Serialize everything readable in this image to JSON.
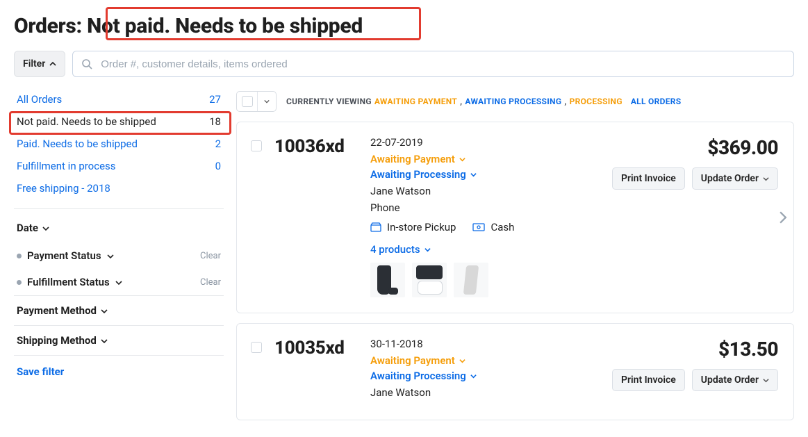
{
  "header": {
    "title_prefix": "Orders:",
    "title_filter": "Not paid. Needs to be shipped"
  },
  "filterBar": {
    "filter_label": "Filter",
    "search_placeholder": "Order #, customer details, items ordered"
  },
  "sidebar": {
    "saved": [
      {
        "label": "All Orders",
        "count": "27",
        "active": false
      },
      {
        "label": "Not paid. Needs to be shipped",
        "count": "18",
        "active": true
      },
      {
        "label": "Paid. Needs to be shipped",
        "count": "2",
        "active": false
      },
      {
        "label": "Fulfillment in process",
        "count": "0",
        "active": false
      },
      {
        "label": "Free shipping - 2018",
        "count": "",
        "active": false
      }
    ],
    "date_label": "Date",
    "payment_status_label": "Payment Status",
    "fulfillment_status_label": "Fulfillment Status",
    "clear_label": "Clear",
    "payment_method_label": "Payment Method",
    "shipping_method_label": "Shipping Method",
    "save_filter_label": "Save filter"
  },
  "listHeader": {
    "currently_viewing": "CURRENTLY VIEWING",
    "awaiting_payment": "AWAITING PAYMENT",
    "awaiting_processing": "AWAITING PROCESSING",
    "processing": "PROCESSING",
    "all_orders": "ALL ORDERS"
  },
  "orders": [
    {
      "number": "10036xd",
      "date": "22-07-2019",
      "payment_status": "Awaiting Payment",
      "fulfillment_status": "Awaiting Processing",
      "customer": "Jane Watson",
      "contact": "Phone",
      "shipping": "In-store Pickup",
      "payment": "Cash",
      "products_label": "4 products",
      "price": "$369.00",
      "print_label": "Print Invoice",
      "update_label": "Update Order"
    },
    {
      "number": "10035xd",
      "date": "30-11-2018",
      "payment_status": "Awaiting Payment",
      "fulfillment_status": "Awaiting Processing",
      "customer": "Jane Watson",
      "price": "$13.50",
      "print_label": "Print Invoice",
      "update_label": "Update Order"
    }
  ]
}
